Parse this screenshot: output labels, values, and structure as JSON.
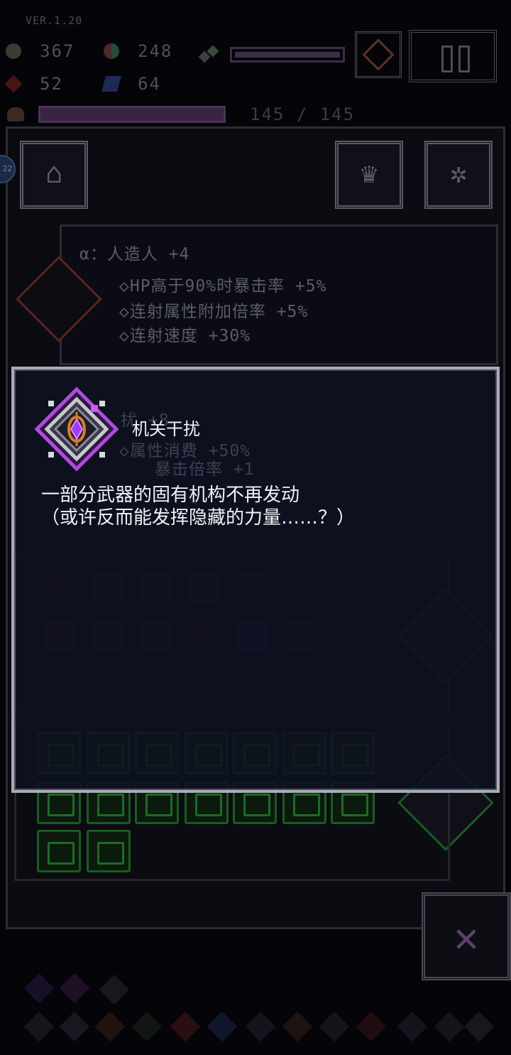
{
  "hud": {
    "version": "VER.1.20",
    "gear_count": "367",
    "orb_count": "248",
    "red_count": "52",
    "blue_count": "64",
    "hp_text": "145 / 145",
    "icons": [
      "gear-icon",
      "orb-icon",
      "crystals-icon",
      "red-gem-icon",
      "blue-flask-icon",
      "heart-icon",
      "pause-icon"
    ]
  },
  "panel": {
    "side_bubble": "22",
    "buttons": [
      "home-icon",
      "crown-icon",
      "settings-icon"
    ],
    "skills": [
      {
        "title": "α：人造人 +4",
        "lines": [
          "◇HP高于90%时暴击率 +5%",
          "◇连射属性附加倍率 +5%",
          "◇连射速度 +30%"
        ]
      },
      {
        "title": "扰 +8",
        "lines": [
          "◇属性消费 +50%",
          "暴击倍率 +1"
        ]
      }
    ]
  },
  "popup": {
    "title": "机关干扰",
    "desc_line1": "一部分武器的固有机构不再发动",
    "desc_line2": "（或许反而能发挥隐藏的力量……？）",
    "icon": "purple-gem-sigil-icon",
    "colors": {
      "accent": "#b04ae0",
      "gem": "#9b3ff0",
      "frame": "#c7c7d2"
    }
  }
}
